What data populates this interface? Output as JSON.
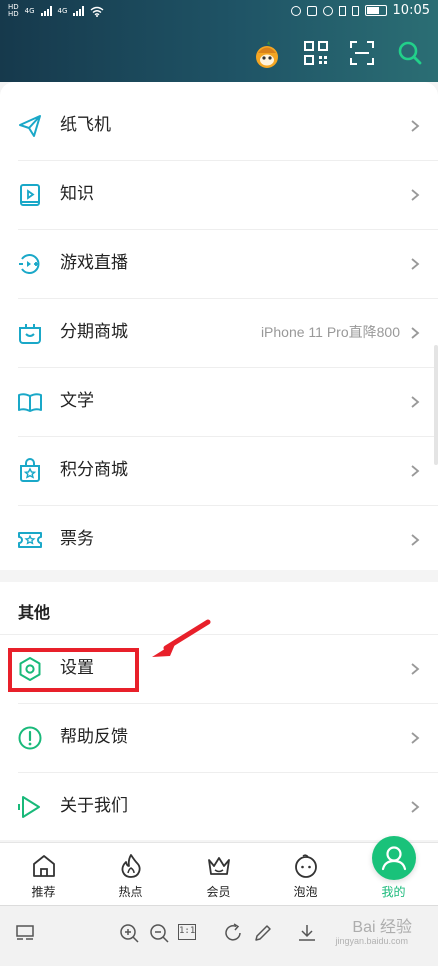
{
  "status_bar": {
    "time": "10:05",
    "sim_labels": [
      "4G",
      "4G"
    ],
    "hd_labels": [
      "HD",
      "HD"
    ]
  },
  "header": {
    "icons": [
      "avatar-icon",
      "qr-code-icon",
      "scan-icon",
      "search-icon"
    ]
  },
  "menu_items": [
    {
      "label": "纸飞机",
      "icon": "paper-plane-icon",
      "extra": ""
    },
    {
      "label": "知识",
      "icon": "knowledge-book-icon",
      "extra": ""
    },
    {
      "label": "游戏直播",
      "icon": "game-live-icon",
      "extra": ""
    },
    {
      "label": "分期商城",
      "icon": "installment-mall-icon",
      "extra": "iPhone 11 Pro直降800"
    },
    {
      "label": "文学",
      "icon": "literature-book-icon",
      "extra": ""
    },
    {
      "label": "积分商城",
      "icon": "points-mall-icon",
      "extra": ""
    },
    {
      "label": "票务",
      "icon": "ticket-icon",
      "extra": ""
    }
  ],
  "other_section": {
    "title": "其他",
    "items": [
      {
        "label": "设置",
        "icon": "settings-icon"
      },
      {
        "label": "帮助反馈",
        "icon": "help-icon"
      },
      {
        "label": "关于我们",
        "icon": "about-icon"
      }
    ]
  },
  "bottom_nav": {
    "tabs": [
      {
        "label": "推荐",
        "icon": "home-icon",
        "active": false
      },
      {
        "label": "热点",
        "icon": "flame-icon",
        "active": false
      },
      {
        "label": "会员",
        "icon": "crown-icon",
        "active": false
      },
      {
        "label": "泡泡",
        "icon": "bubble-face-icon",
        "active": false
      },
      {
        "label": "我的",
        "icon": "profile-icon",
        "active": true
      }
    ]
  },
  "viewer_toolbar": {
    "icons": [
      "thumbnail-icon",
      "zoom-in-icon",
      "zoom-out-icon",
      "actual-size-icon",
      "rotate-icon",
      "edit-icon",
      "download-icon"
    ],
    "actual_size_label": "1:1"
  },
  "watermark": {
    "text": "Bai 经验",
    "sub": "jingyan.baidu.com"
  },
  "colors": {
    "accent": "#19b97a",
    "highlight": "#e8202a",
    "icon": "#1aa8c8",
    "header_bg": "#1f5466"
  }
}
